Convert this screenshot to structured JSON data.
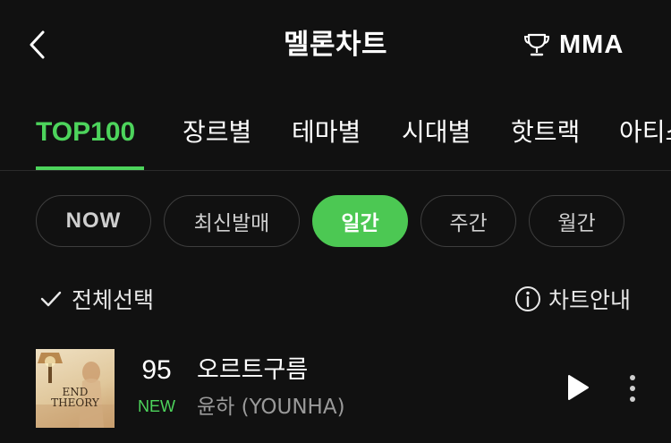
{
  "header": {
    "title": "멜론차트",
    "back_icon": "chevron-left-icon",
    "mma_icon": "trophy-icon",
    "mma_label": "MMA"
  },
  "tabs": [
    {
      "label": "TOP100",
      "active": true
    },
    {
      "label": "장르별",
      "active": false
    },
    {
      "label": "테마별",
      "active": false
    },
    {
      "label": "시대별",
      "active": false
    },
    {
      "label": "핫트랙",
      "active": false
    },
    {
      "label": "아티스트",
      "active": false
    }
  ],
  "periods": [
    {
      "label": "NOW",
      "selected": false
    },
    {
      "label": "최신발매",
      "selected": false
    },
    {
      "label": "일간",
      "selected": true
    },
    {
      "label": "주간",
      "selected": false
    },
    {
      "label": "월간",
      "selected": false
    }
  ],
  "toolbar": {
    "select_all_label": "전체선택",
    "select_all_icon": "checkmark-icon",
    "chart_info_label": "차트안내",
    "chart_info_icon": "info-icon"
  },
  "songs": [
    {
      "rank": "95",
      "change": "NEW",
      "title": "오르트구름",
      "artist": "윤하 (YOUNHA)",
      "album_text": [
        "END",
        "THEORY"
      ]
    }
  ],
  "colors": {
    "background": "#111111",
    "accent": "#4dd45c",
    "selected_chip": "#4cc853",
    "secondary_text": "#9a9a9a"
  }
}
